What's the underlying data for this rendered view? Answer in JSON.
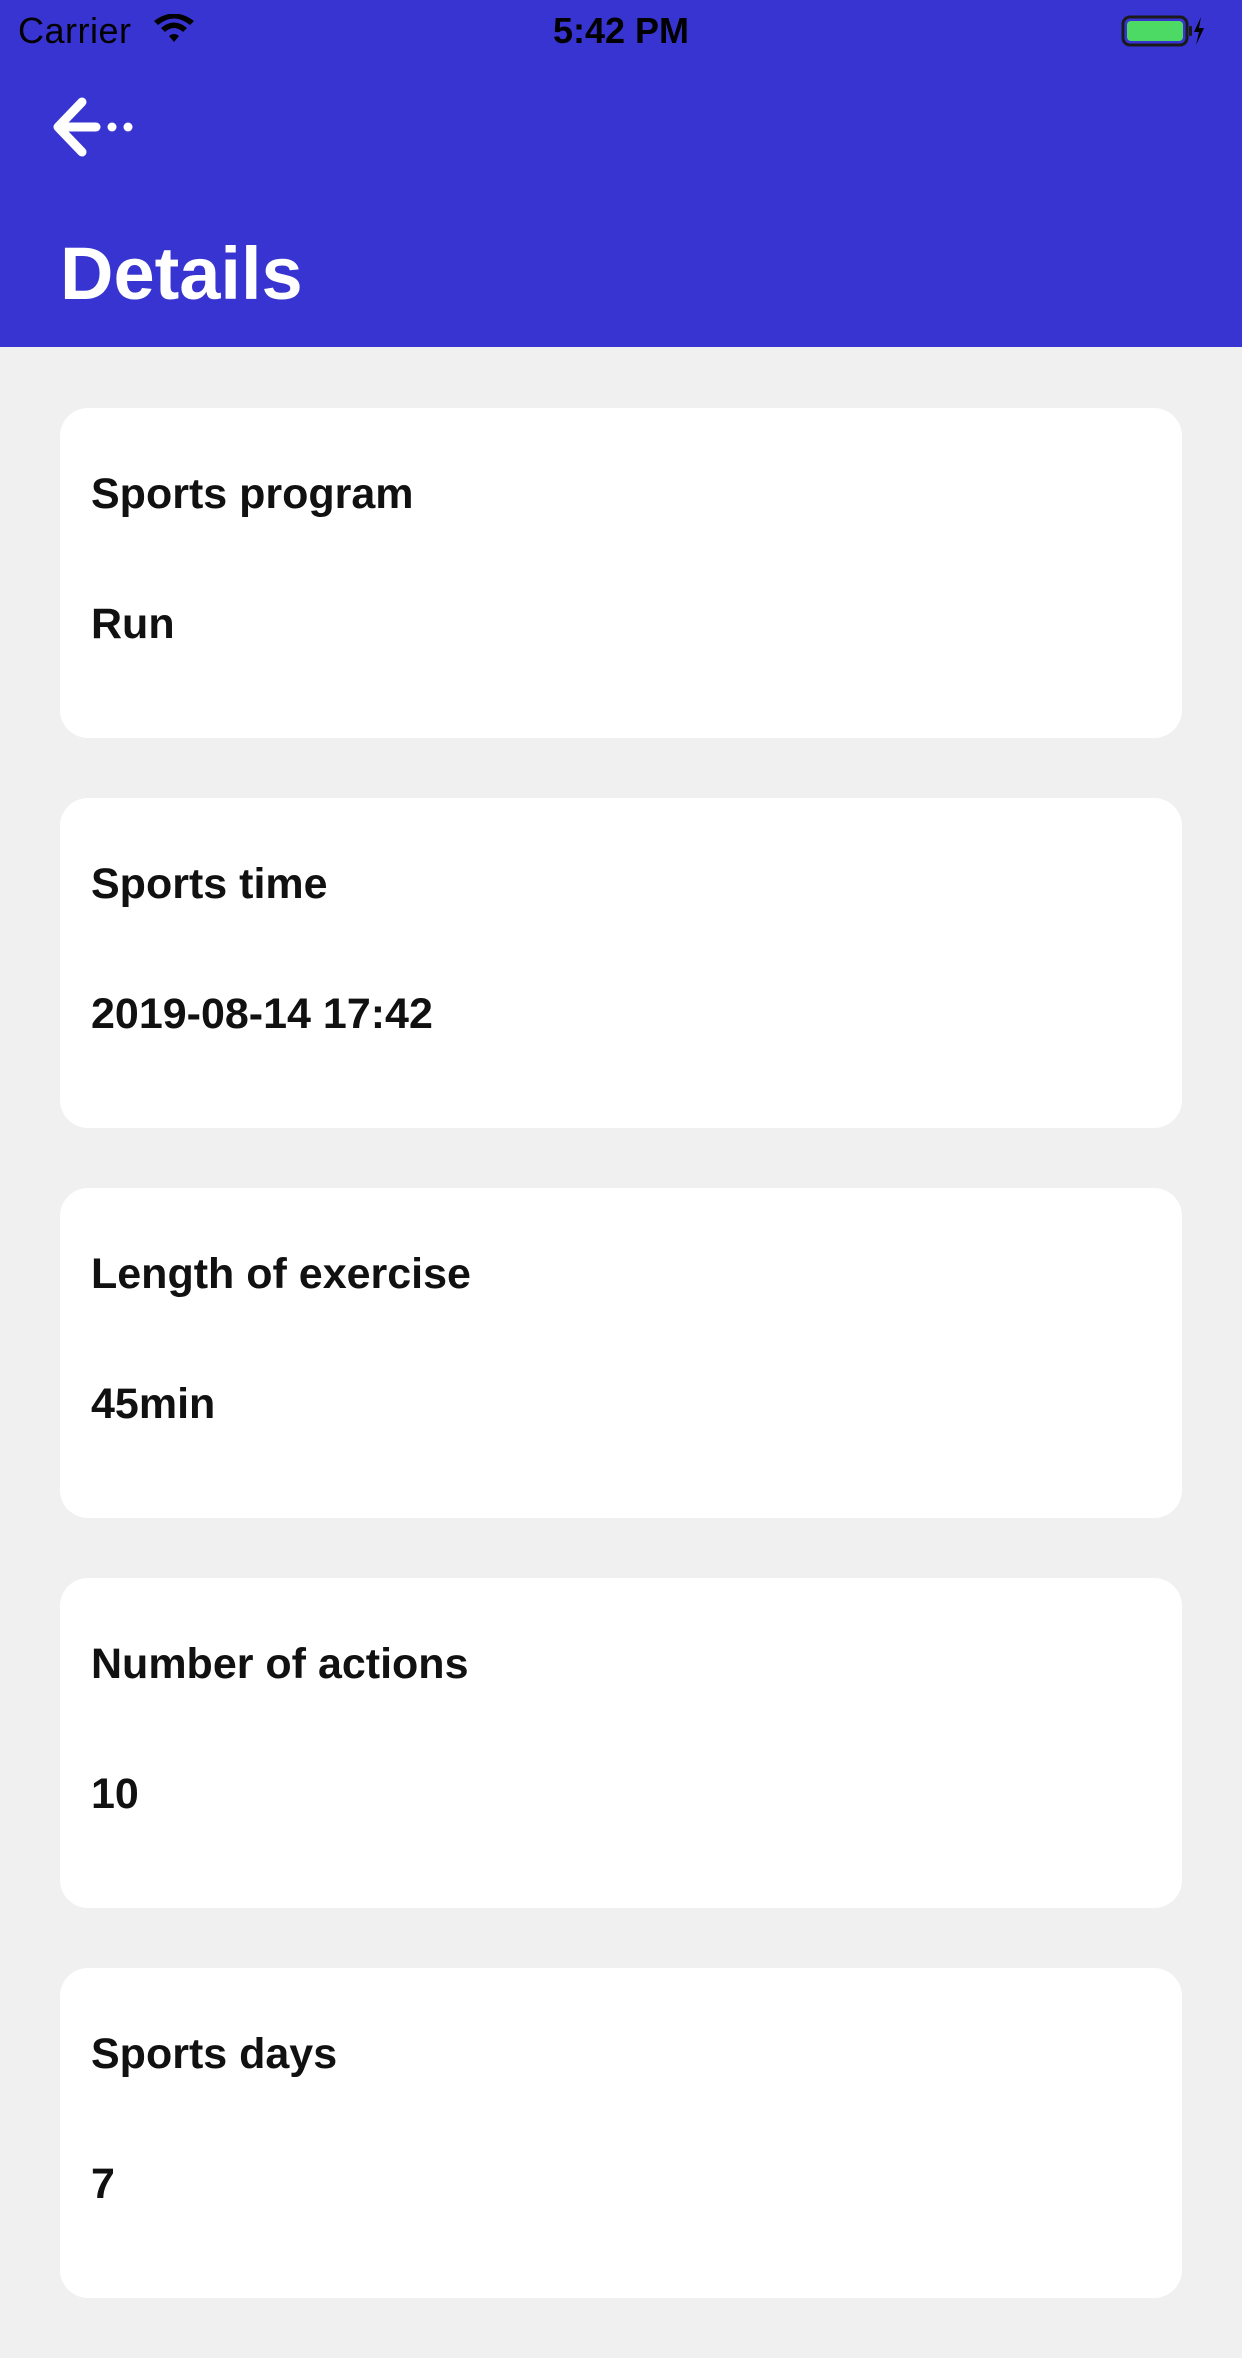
{
  "status_bar": {
    "carrier": "Carrier",
    "time": "5:42 PM",
    "wifi_icon": "wifi-icon",
    "battery_icon": "battery-charging-icon",
    "battery_color": "#4cd964"
  },
  "header": {
    "back_icon": "arrow-left-icon",
    "title": "Details",
    "background_color": "#3834d1"
  },
  "details": [
    {
      "label": "Sports program",
      "value": "Run"
    },
    {
      "label": "Sports time",
      "value": "2019-08-14 17:42"
    },
    {
      "label": "Length of exercise",
      "value": "45min"
    },
    {
      "label": "Number of actions",
      "value": "10"
    },
    {
      "label": "Sports days",
      "value": "7"
    }
  ]
}
